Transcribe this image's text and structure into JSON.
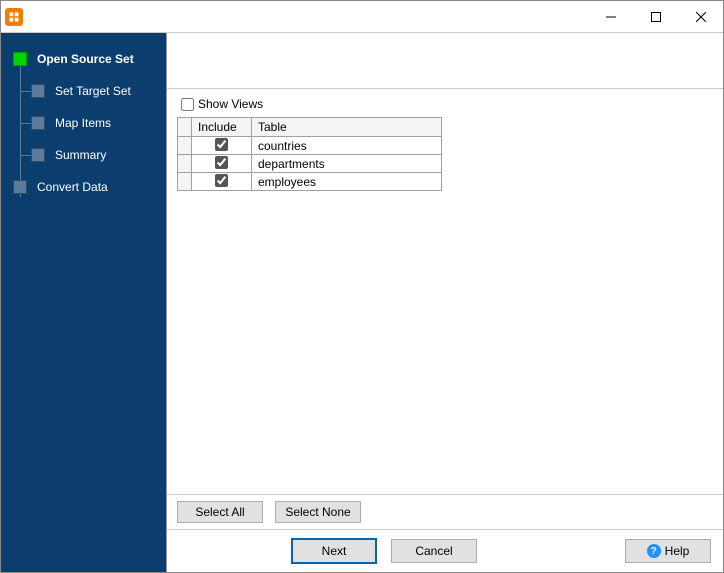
{
  "titlebar": {
    "title": ""
  },
  "sidebar": {
    "steps": [
      {
        "label": "Open Source Set",
        "active": true,
        "child": false
      },
      {
        "label": "Set Target Set",
        "active": false,
        "child": true
      },
      {
        "label": "Map Items",
        "active": false,
        "child": true
      },
      {
        "label": "Summary",
        "active": false,
        "child": true
      },
      {
        "label": "Convert Data",
        "active": false,
        "child": false
      }
    ]
  },
  "main": {
    "show_views_label": "Show Views",
    "show_views_checked": false,
    "columns": {
      "include": "Include",
      "table": "Table"
    },
    "rows": [
      {
        "included": true,
        "table": "countries"
      },
      {
        "included": true,
        "table": "departments"
      },
      {
        "included": true,
        "table": "employees"
      }
    ],
    "select_all": "Select All",
    "select_none": "Select None"
  },
  "footer": {
    "next": "Next",
    "cancel": "Cancel",
    "help": "Help"
  }
}
